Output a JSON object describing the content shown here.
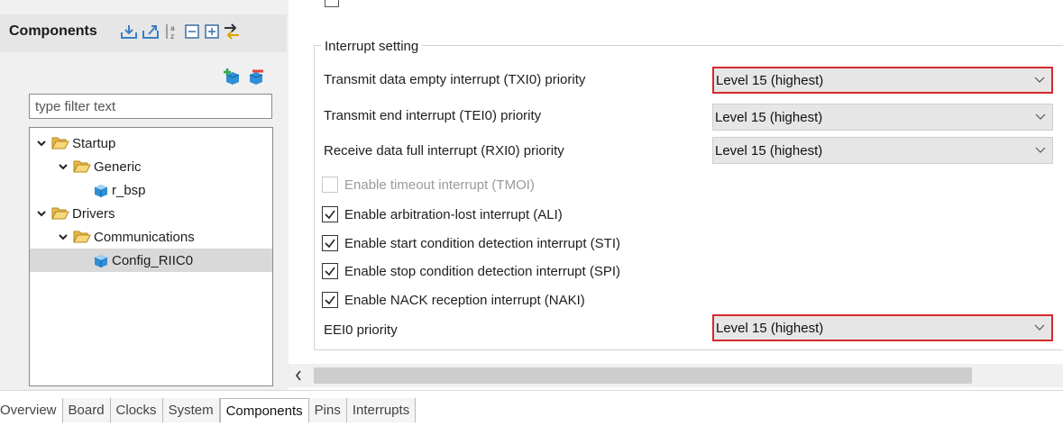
{
  "components_panel": {
    "title": "Components",
    "filter_placeholder": "type filter text",
    "tree": [
      {
        "label": "Startup",
        "type": "folder",
        "expanded": true
      },
      {
        "label": "Generic",
        "type": "folder",
        "expanded": true
      },
      {
        "label": "r_bsp",
        "type": "component"
      },
      {
        "label": "Drivers",
        "type": "folder",
        "expanded": true
      },
      {
        "label": "Communications",
        "type": "folder",
        "expanded": true
      },
      {
        "label": "Config_RIIC0",
        "type": "component",
        "selected": true
      }
    ]
  },
  "config": {
    "group_title": "Interrupt setting",
    "txi_label": "Transmit data empty interrupt (TXI0) priority",
    "txi_value": "Level 15 (highest)",
    "tei_label": "Transmit end interrupt (TEI0) priority",
    "tei_value": "Level 15 (highest)",
    "rxi_label": "Receive data full interrupt (RXI0) priority",
    "rxi_value": "Level 15 (highest)",
    "tmoi_label": "Enable timeout interrupt (TMOI)",
    "tmoi_checked": false,
    "tmoi_enabled": false,
    "ali_label": "Enable arbitration-lost interrupt (ALI)",
    "ali_checked": true,
    "sti_label": "Enable start condition detection interrupt (STI)",
    "sti_checked": true,
    "spi_label": "Enable stop condition detection interrupt (SPI)",
    "spi_checked": true,
    "naki_label": "Enable NACK reception interrupt (NAKI)",
    "naki_checked": true,
    "eei_label": "EEI0 priority",
    "eei_value": "Level 15 (highest)"
  },
  "tabs": [
    "Overview",
    "Board",
    "Clocks",
    "System",
    "Components",
    "Pins",
    "Interrupts"
  ],
  "active_tab": "Components",
  "colors": {
    "highlight_border": "#d42a2a",
    "folder_yellow": "#f2c94c",
    "component_blue": "#2f8fd8"
  }
}
